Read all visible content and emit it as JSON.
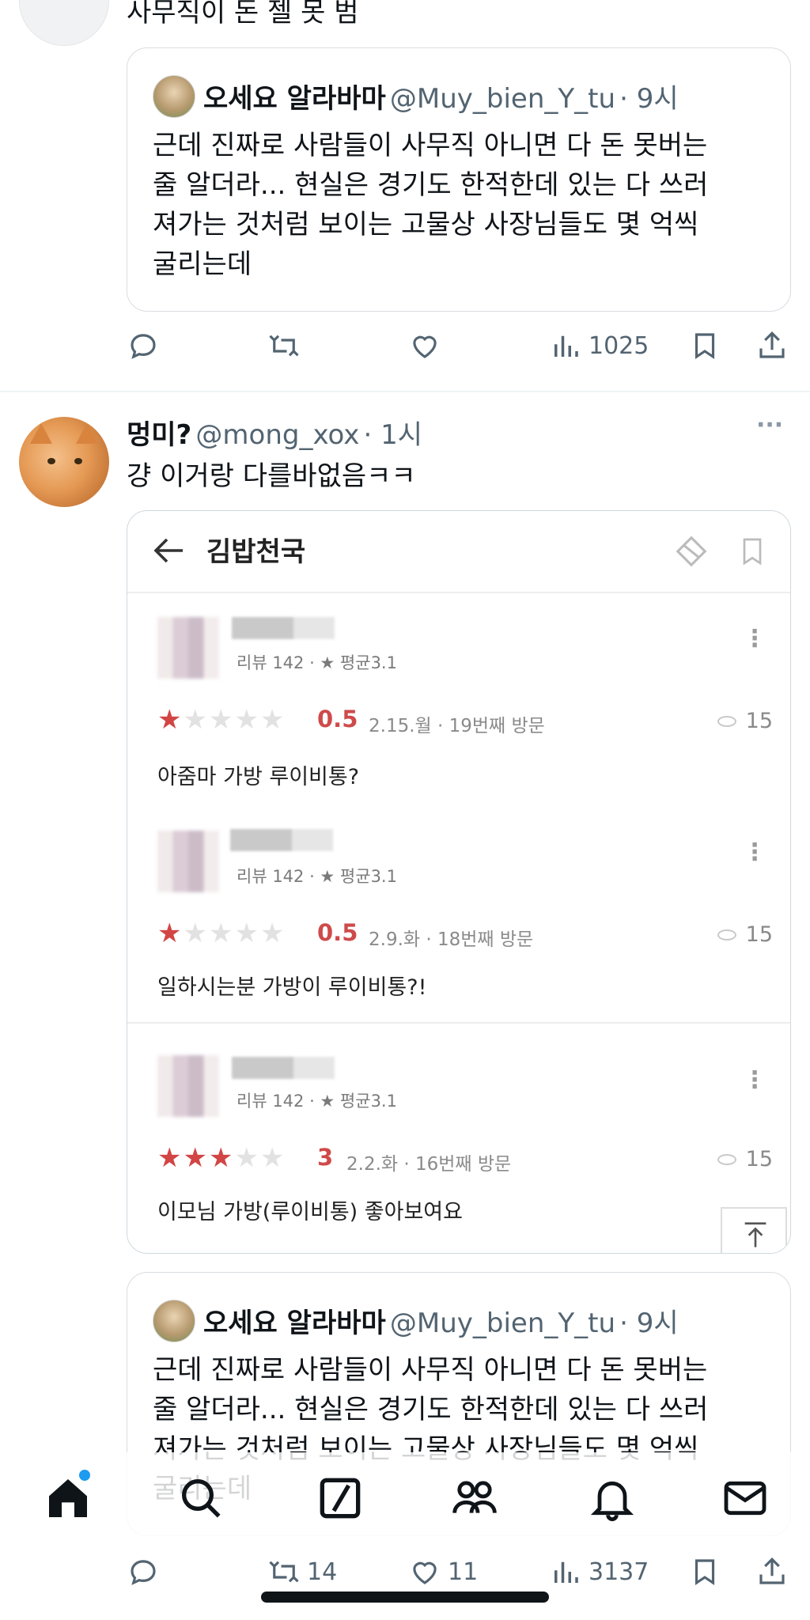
{
  "tweet1": {
    "text_partial": "사무직이 돈 젤 못 범",
    "quote": {
      "name": "오세요 알라바마",
      "handle": "@Muy_bien_Y_tu",
      "time": "· 9시",
      "text": "근데 진짜로 사람들이 사무직 아니면 다 돈 못버는\n줄 알더라... 현실은 경기도 한적한데 있는 다 쓰러\n져가는 것처럼 보이는 고물상 사장님들도 몇 억씩\n굴리는데"
    },
    "actions": {
      "views": "1025"
    }
  },
  "tweet2": {
    "name": "멍미?",
    "handle": "@mong_xox",
    "time": "· 1시",
    "text": "걍 이거랑 다를바없음ㅋㅋ",
    "more": "···",
    "embed": {
      "title": "김밥천국",
      "reviews": [
        {
          "meta": "리뷰 142 · ★ 평균3.1",
          "stars": 0.5,
          "score": "0.5",
          "date": "2.15.월 · 19번째 방문",
          "views": "15",
          "text": "아줌마 가방 루이비통?"
        },
        {
          "meta": "리뷰 142 · ★ 평균3.1",
          "stars": 0.5,
          "score": "0.5",
          "date": "2.9.화 · 18번째 방문",
          "views": "15",
          "text": "일하시는분 가방이 루이비통?!"
        },
        {
          "meta": "리뷰 142 · ★ 평균3.1",
          "stars": 3,
          "score": "3",
          "date": "2.2.화 · 16번째 방문",
          "views": "15",
          "text": "이모님 가방(루이비통) 좋아보여요"
        }
      ]
    },
    "quote": {
      "name": "오세요 알라바마",
      "handle": "@Muy_bien_Y_tu",
      "time": "· 9시",
      "text": "근데 진짜로 사람들이 사무직 아니면 다 돈 못버는\n줄 알더라... 현실은 경기도 한적한데 있는 다 쓰러\n져가는 것처럼 보이는 고물상 사장님들도 몇 억씩\n굴리는데"
    },
    "actions": {
      "retweets": "14",
      "likes": "11",
      "views": "3137"
    }
  },
  "icons": [
    "reply-icon",
    "retweet-icon",
    "like-icon",
    "views-icon",
    "bookmark-icon",
    "share-icon",
    "home-icon",
    "search-icon",
    "grok-icon",
    "communities-icon",
    "notifications-icon",
    "messages-icon"
  ],
  "colors": {
    "text": "#0f1419",
    "muted": "#536471",
    "accent": "#1d9bf0",
    "review_red": "#d24545"
  }
}
